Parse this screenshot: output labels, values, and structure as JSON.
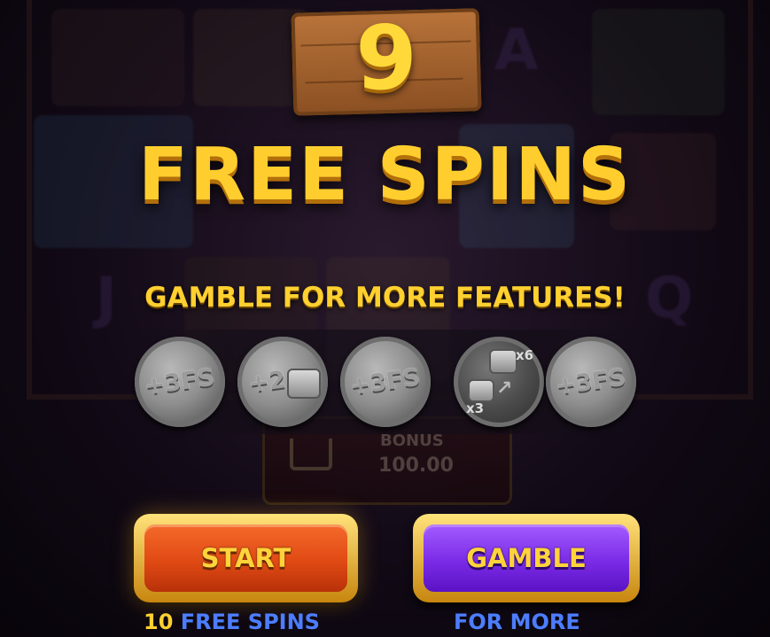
{
  "spin_count": "9",
  "title": "FREE SPINS",
  "gamble_heading": "GAMBLE FOR MORE FEATURES!",
  "coins": [
    {
      "label": "+3FS",
      "icon": "free-spins-coin"
    },
    {
      "label": "+2",
      "icon": "sticky-can-coin"
    },
    {
      "label": "+3FS",
      "icon": "free-spins-coin"
    },
    {
      "label_top": "x6",
      "label_bottom": "x3",
      "icon": "multiplier-coin"
    },
    {
      "label": "+3FS",
      "icon": "free-spins-coin"
    }
  ],
  "background_bonus": {
    "label": "BONUS",
    "value": "100.00"
  },
  "buttons": {
    "start": {
      "label": "START",
      "caption_number": "10",
      "caption_text": "FREE SPINS"
    },
    "gamble": {
      "label": "GAMBLE",
      "caption_text": "FOR MORE"
    }
  },
  "colors": {
    "gold_text": "#ffd02f",
    "start_button": "#e04a14",
    "gamble_button": "#7a2be6",
    "caption_blue": "#4c7dff"
  }
}
